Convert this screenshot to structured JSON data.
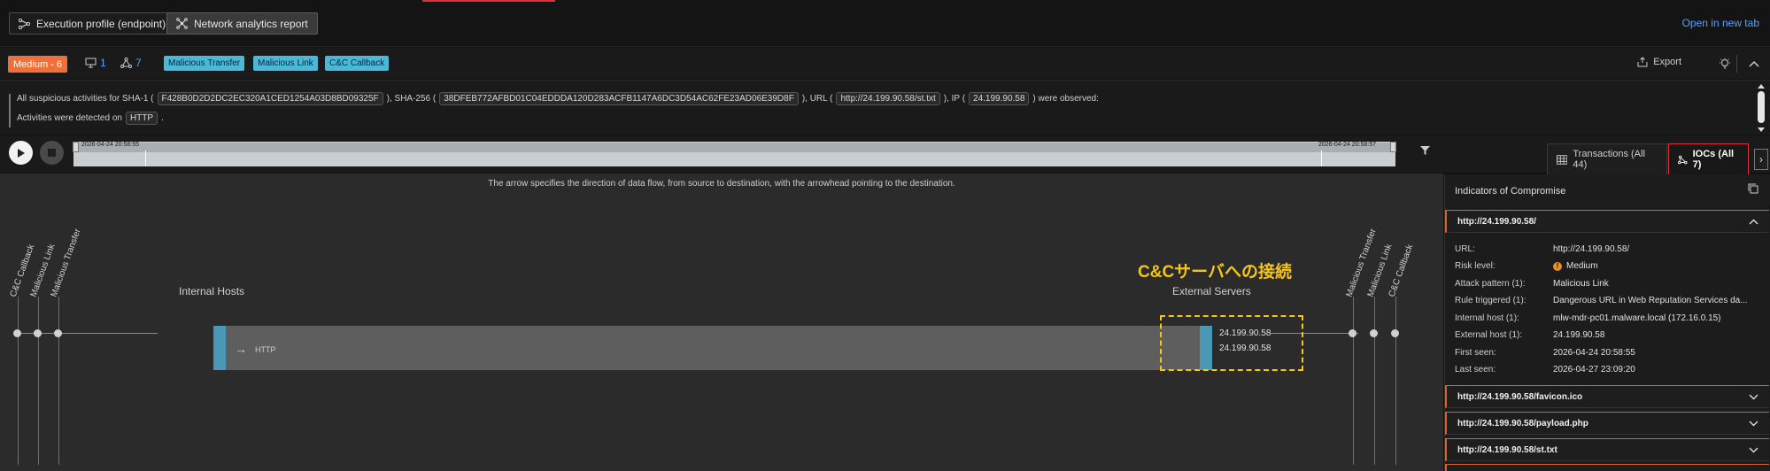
{
  "top_tabs": [
    {
      "label": "Execution profile (endpoint)",
      "icon": "share-nodes-icon"
    },
    {
      "label": "Network analytics report",
      "icon": "network-icon"
    }
  ],
  "open_new_tab": "Open in new tab",
  "header": {
    "severity": "Medium - 6",
    "endpoint_count": "1",
    "node_count": "7",
    "tags": [
      "Malicious Transfer",
      "Malicious Link",
      "C&C Callback"
    ],
    "export_label": "Export"
  },
  "description": {
    "line1": {
      "p1": "All suspicious activities for SHA-1 (",
      "sha1": "F428B0D2D2DC2EC320A1CED1254A03D8BD09325F",
      "p2": "), SHA-256 (",
      "sha256": "38DFEB772AFBD01C04EDDDA120D283ACFB1147A6DC3D54AC62FE23AD06E39D8F",
      "p3": "), URL (",
      "url": "http://24.199.90.58/st.txt",
      "p4": "), IP (",
      "ip": "24.199.90.58",
      "p5": ") were observed:"
    },
    "line2": {
      "p1": "Activities were detected on",
      "proto": "HTTP",
      "p2": "."
    }
  },
  "timeline": {
    "start": "2026-04-24 20:58:55",
    "end": "2026-04-24 20:58:57"
  },
  "right_tabs": {
    "transactions": "Transactions (All 44)",
    "iocs": "IOCs (All 7)"
  },
  "graph": {
    "note": "The arrow specifies the direction of data flow, from source to destination, with the arrowhead pointing to the destination.",
    "internal_label": "Internal Hosts",
    "external_label": "External Servers",
    "annotation": "C&Cサーバへの接続",
    "left_categories": [
      "C&C Callback",
      "Malicious Link",
      "Malicious Transfer"
    ],
    "right_categories": [
      "Malicious Transfer",
      "Malicious Link",
      "C&C Callback"
    ],
    "flow_protocol": "HTTP",
    "server_ips": [
      "24.199.90.58",
      "24.199.90.58"
    ]
  },
  "panel": {
    "title": "Indicators of Compromise",
    "expanded": {
      "header": "http://24.199.90.58/",
      "fields": [
        {
          "k": "URL:",
          "v": "http://24.199.90.58/"
        },
        {
          "k": "Risk level:",
          "v": "Medium"
        },
        {
          "k": "Attack pattern (1):",
          "v": "Malicious Link"
        },
        {
          "k": "Rule triggered (1):",
          "v": "Dangerous URL in Web Reputation Services da..."
        },
        {
          "k": "Internal host (1):",
          "v": "mlw-mdr-pc01.malware.local (172.16.0.15)"
        },
        {
          "k": "External host (1):",
          "v": "24.199.90.58"
        },
        {
          "k": "First seen:",
          "v": "2026-04-24 20:58:55"
        },
        {
          "k": "Last seen:",
          "v": "2026-04-27 23:09:20"
        }
      ]
    },
    "collapsed": [
      "http://24.199.90.58/favicon.ico",
      "http://24.199.90.58/payload.php",
      "http://24.199.90.58/st.txt"
    ]
  },
  "colors": {
    "accent": "#d8323c",
    "severity": "#f0703a",
    "tag": "#4ab8d8",
    "link": "#4ea3ff",
    "annotation": "#f5c518",
    "node": "#4a98b5"
  }
}
